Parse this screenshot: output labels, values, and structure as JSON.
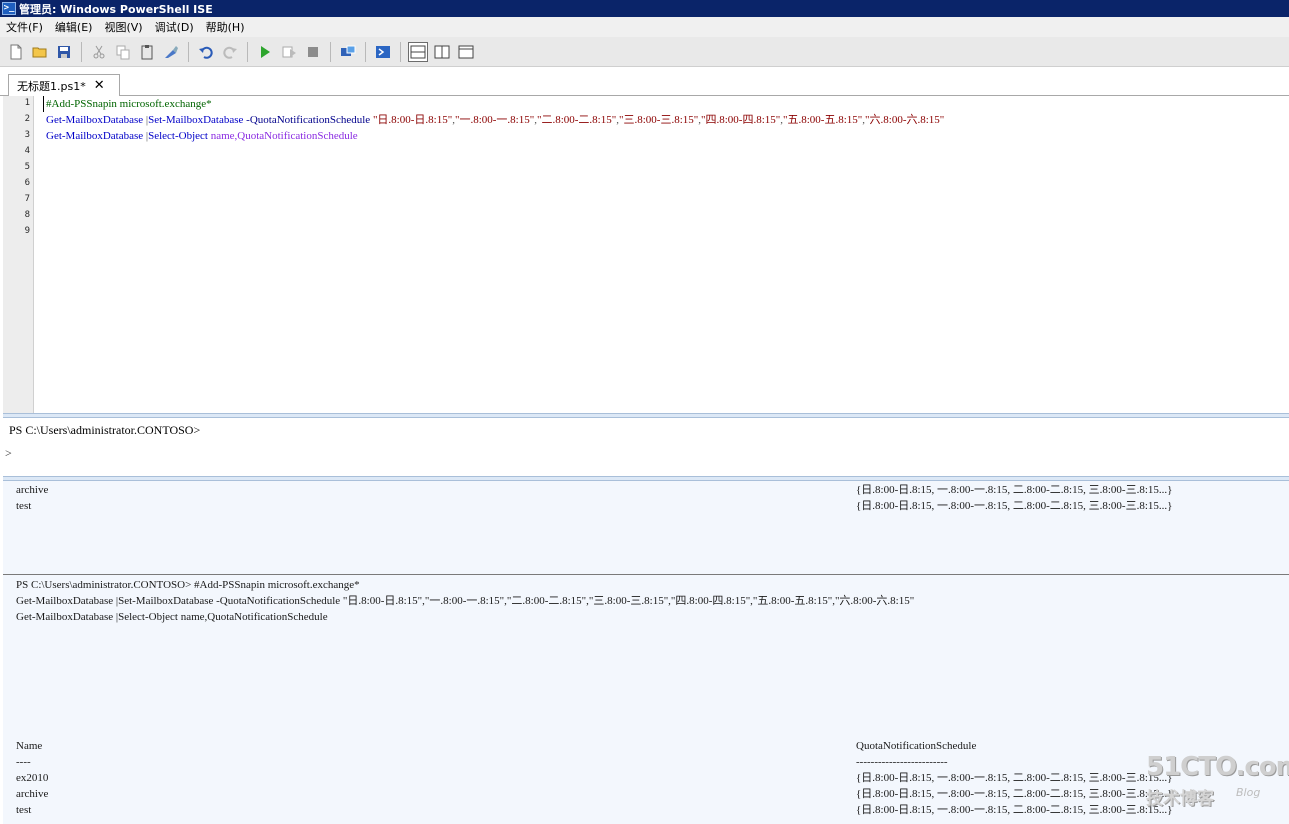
{
  "window": {
    "title": "管理员: Windows PowerShell ISE",
    "icon": "powershell-icon"
  },
  "menu": [
    "文件(F)",
    "编辑(E)",
    "视图(V)",
    "调试(D)",
    "帮助(H)"
  ],
  "toolbar": {
    "icons": [
      "new-file-icon",
      "open-file-icon",
      "save-icon",
      "cut-icon",
      "copy-icon",
      "paste-icon",
      "clear-icon",
      "undo-icon",
      "redo-icon",
      "run-icon",
      "run-selection-icon",
      "stop-icon",
      "remote-tab-icon",
      "powershell-icon",
      "layout-top-icon",
      "layout-right-icon",
      "layout-max-icon"
    ]
  },
  "tab": {
    "label": "无标题1.ps1*"
  },
  "editor": {
    "line_numbers": [
      "1",
      "2",
      "3",
      "4",
      "5",
      "6",
      "7",
      "8",
      "9"
    ],
    "lines": [
      [
        {
          "t": "#Add-PSSnapin microsoft.exchange*",
          "c": "c-comment"
        }
      ],
      [
        {
          "t": "Get-MailboxDatabase",
          "c": "c-cmd"
        },
        {
          "t": " |",
          "c": "c-op"
        },
        {
          "t": "Set-MailboxDatabase",
          "c": "c-cmd"
        },
        {
          "t": " -QuotaNotificationSchedule",
          "c": "c-param"
        },
        {
          "t": " \"日.8:00-日.8:15\"",
          "c": "c-str"
        },
        {
          "t": ",",
          "c": "c-op"
        },
        {
          "t": "\"一.8:00-一.8:15\"",
          "c": "c-str"
        },
        {
          "t": ",",
          "c": "c-op"
        },
        {
          "t": "\"二.8:00-二.8:15\"",
          "c": "c-str"
        },
        {
          "t": ",",
          "c": "c-op"
        },
        {
          "t": "\"三.8:00-三.8:15\"",
          "c": "c-str"
        },
        {
          "t": ",",
          "c": "c-op"
        },
        {
          "t": "\"四.8:00-四.8:15\"",
          "c": "c-str"
        },
        {
          "t": ",",
          "c": "c-op"
        },
        {
          "t": "\"五.8:00-五.8:15\"",
          "c": "c-str"
        },
        {
          "t": ",",
          "c": "c-op"
        },
        {
          "t": "\"六.8:00-六.8:15\"",
          "c": "c-str"
        }
      ],
      [
        {
          "t": "Get-MailboxDatabase",
          "c": "c-cmd"
        },
        {
          "t": " |",
          "c": "c-op"
        },
        {
          "t": "Select-Object",
          "c": "c-cmd"
        },
        {
          "t": " name,QuotaNotificationSchedule",
          "c": "c-arg"
        }
      ]
    ]
  },
  "command_pane": {
    "prompt": "PS C:\\Users\\administrator.CONTOSO>",
    "continuation": ">"
  },
  "output": {
    "top_rows": [
      {
        "name": "archive",
        "schedule": "{日.8:00-日.8:15, 一.8:00-一.8:15, 二.8:00-二.8:15, 三.8:00-三.8:15...}"
      },
      {
        "name": "test",
        "schedule": "{日.8:00-日.8:15, 一.8:00-一.8:15, 二.8:00-二.8:15, 三.8:00-三.8:15...}"
      }
    ],
    "echo_lines": [
      "PS C:\\Users\\administrator.CONTOSO> #Add-PSSnapin microsoft.exchange*",
      "Get-MailboxDatabase |Set-MailboxDatabase -QuotaNotificationSchedule \"日.8:00-日.8:15\",\"一.8:00-一.8:15\",\"二.8:00-二.8:15\",\"三.8:00-三.8:15\",\"四.8:00-四.8:15\",\"五.8:00-五.8:15\",\"六.8:00-六.8:15\"",
      "Get-MailboxDatabase |Select-Object name,QuotaNotificationSchedule"
    ],
    "headers": {
      "name": "Name",
      "schedule": "QuotaNotificationSchedule"
    },
    "underlines": {
      "name": "----",
      "schedule": "-------------------------"
    },
    "rows": [
      {
        "name": "ex2010",
        "schedule": "{日.8:00-日.8:15, 一.8:00-一.8:15, 二.8:00-二.8:15, 三.8:00-三.8:15...}"
      },
      {
        "name": "archive",
        "schedule": "{日.8:00-日.8:15, 一.8:00-一.8:15, 二.8:00-二.8:15, 三.8:00-三.8:15...}"
      },
      {
        "name": "test",
        "schedule": "{日.8:00-日.8:15, 一.8:00-一.8:15, 二.8:00-二.8:15, 三.8:00-三.8:15...}"
      }
    ]
  },
  "watermark": {
    "top": "51CTO.com",
    "bottom": "技术博客",
    "blog": "Blog"
  }
}
